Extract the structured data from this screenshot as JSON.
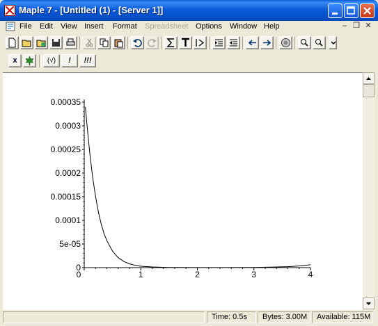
{
  "window": {
    "title": "Maple 7 - [Untitled (1) - [Server 1]]"
  },
  "menu": [
    {
      "label": "File",
      "enabled": true
    },
    {
      "label": "Edit",
      "enabled": true
    },
    {
      "label": "View",
      "enabled": true
    },
    {
      "label": "Insert",
      "enabled": true
    },
    {
      "label": "Format",
      "enabled": true
    },
    {
      "label": "Spreadsheet",
      "enabled": false
    },
    {
      "label": "Options",
      "enabled": true
    },
    {
      "label": "Window",
      "enabled": true
    },
    {
      "label": "Help",
      "enabled": true
    }
  ],
  "toolbar_icons": [
    "new-document-icon",
    "open-folder-icon",
    "open-url-icon",
    "save-icon",
    "print-icon",
    "cut-icon",
    "copy-icon",
    "paste-icon",
    "undo-icon",
    "redo-icon",
    "sigma-icon",
    "text-icon",
    "prompt-icon",
    "indent-icon",
    "outdent-icon",
    "back-icon",
    "forward-icon",
    "stop-icon",
    "zoom-in-icon",
    "zoom-out-icon"
  ],
  "toolbar2": {
    "exec_label": "x",
    "sqrt_label": "(√)",
    "bang_label": "!",
    "bang3_label": "!!!"
  },
  "status": {
    "time": "Time:   0.5s",
    "bytes": "Bytes: 3.00M",
    "available": "Available: 115M"
  },
  "colors": {
    "titlebar": "#0b5bd9",
    "chrome": "#ece9d8",
    "close_button": "#c4381a",
    "curve": "#000000"
  },
  "chart_data": {
    "type": "line",
    "title": "",
    "xlabel": "",
    "ylabel": "",
    "xlim": [
      0,
      4
    ],
    "ylim": [
      0,
      0.00035
    ],
    "xticks": [
      "0",
      "1",
      "2",
      "3",
      "4"
    ],
    "yticks": [
      "0",
      "5e-05",
      "0.0001",
      "0.00015",
      "0.0002",
      "0.00025",
      "0.0003",
      "0.00035"
    ],
    "grid": false,
    "series": [
      {
        "x": [
          0.02,
          0.05,
          0.1,
          0.15,
          0.2,
          0.25,
          0.3,
          0.35,
          0.4,
          0.5,
          0.6,
          0.7,
          0.8,
          0.9,
          1.0,
          1.2,
          1.5,
          2.0,
          2.5,
          3.0,
          3.3,
          3.6,
          3.8,
          4.0
        ],
        "y": [
          0.00034,
          0.0003,
          0.00024,
          0.00019,
          0.00015,
          0.000118,
          9.2e-05,
          7.2e-05,
          5.7e-05,
          3.5e-05,
          2.1e-05,
          1.3e-05,
          8e-06,
          5e-06,
          3e-06,
          1.5e-06,
          5e-07,
          2e-07,
          2e-07,
          5e-07,
          1.2e-06,
          2e-06,
          3.5e-06,
          6e-06
        ]
      }
    ]
  }
}
